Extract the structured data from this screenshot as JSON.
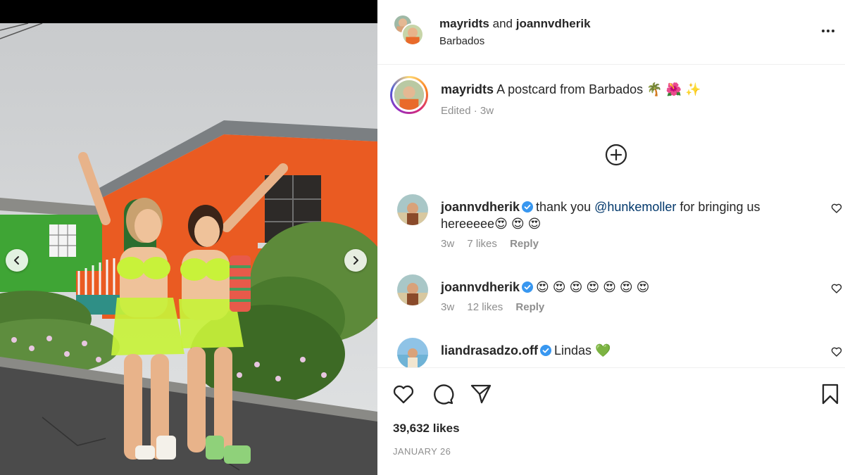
{
  "header": {
    "user1": "mayridts",
    "and_text": "and",
    "user2": "joannvdherik",
    "location": "Barbados"
  },
  "caption": {
    "username": "mayridts",
    "text": "A postcard from Barbados 🌴 🌺 ✨",
    "meta": "Edited · 3w"
  },
  "comments": [
    {
      "username": "joannvdherik",
      "verified": true,
      "text_before": "thank you ",
      "mention": "@hunkemoller",
      "text_after": " for bringing us hereeeee😍 😍 😍",
      "time": "3w",
      "likes": "7 likes",
      "reply": "Reply"
    },
    {
      "username": "joannvdherik",
      "verified": true,
      "text": "😍 😍 😍 😍 😍 😍 😍",
      "time": "3w",
      "likes": "12 likes",
      "reply": "Reply"
    },
    {
      "username": "liandrasadzo.off",
      "verified": true,
      "text": "Lindas 💚"
    }
  ],
  "actions": {
    "likes": "39,632 likes",
    "date": "JANUARY 26"
  },
  "icons": {
    "prev": "chevron-left-icon",
    "next": "chevron-right-icon",
    "more": "more-options-icon",
    "load_more": "plus-circle-icon",
    "like": "heart-icon",
    "comment": "comment-bubble-icon",
    "share": "paper-plane-icon",
    "save": "bookmark-icon",
    "verified": "verified-badge-icon"
  },
  "colors": {
    "verified_blue": "#3897f0",
    "mention_blue": "#00376b",
    "muted_text": "#8e8e8e",
    "border": "#efefef"
  }
}
